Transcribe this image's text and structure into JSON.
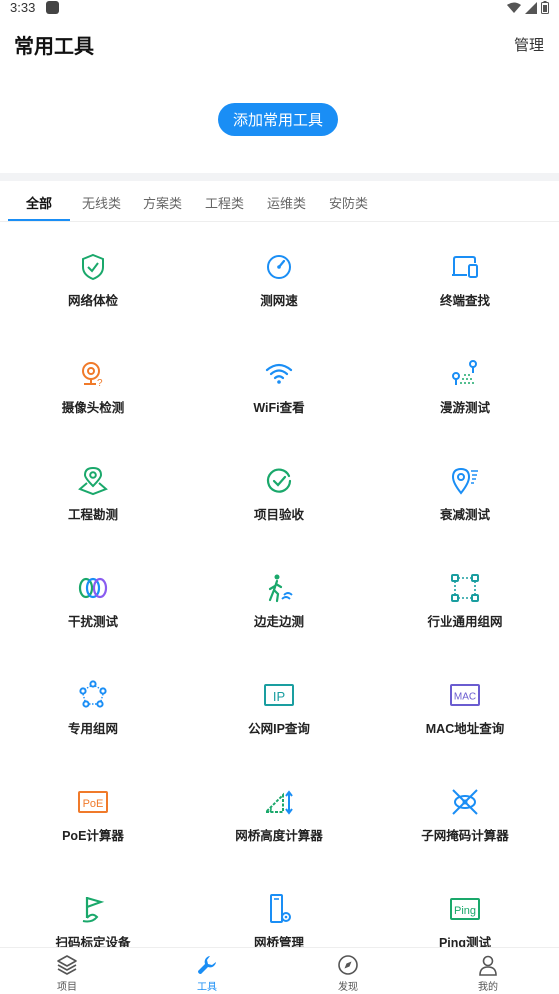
{
  "status": {
    "time": "3:33"
  },
  "header": {
    "title": "常用工具",
    "manage_label": "管理"
  },
  "add_button_label": "添加常用工具",
  "tabs": [
    {
      "label": "全部",
      "active": true
    },
    {
      "label": "无线类"
    },
    {
      "label": "方案类"
    },
    {
      "label": "工程类"
    },
    {
      "label": "运维类"
    },
    {
      "label": "安防类"
    }
  ],
  "tools": [
    {
      "label": "网络体检",
      "icon": "shield-check-icon",
      "color": "#1aa86b"
    },
    {
      "label": "测网速",
      "icon": "speedometer-icon",
      "color": "#1a8ef5"
    },
    {
      "label": "终端查找",
      "icon": "devices-icon",
      "color": "#1a8ef5"
    },
    {
      "label": "摄像头检测",
      "icon": "camera-check-icon",
      "color": "#f07a2a"
    },
    {
      "label": "WiFi查看",
      "icon": "wifi-icon",
      "color": "#1a8ef5"
    },
    {
      "label": "漫游测试",
      "icon": "roaming-icon",
      "color": "#1a8ef5"
    },
    {
      "label": "工程勘测",
      "icon": "map-pin-icon",
      "color": "#1aa86b"
    },
    {
      "label": "项目验收",
      "icon": "check-circle-icon",
      "color": "#1aa86b"
    },
    {
      "label": "衰减测试",
      "icon": "pin-signal-icon",
      "color": "#1a8ef5"
    },
    {
      "label": "干扰测试",
      "icon": "interference-rings-icon",
      "color": "#8a5cf0"
    },
    {
      "label": "边走边测",
      "icon": "walking-icon",
      "color": "#1aa86b"
    },
    {
      "label": "行业通用组网",
      "icon": "network-nodes-icon",
      "color": "#1a9ea0"
    },
    {
      "label": "专用组网",
      "icon": "ring-network-icon",
      "color": "#1a8ef5"
    },
    {
      "label": "公网IP查询",
      "icon": "ip-box-icon",
      "color": "#1a9ea0",
      "text": "IP"
    },
    {
      "label": "MAC地址查询",
      "icon": "mac-box-icon",
      "color": "#6a5cd0",
      "text": "MAC"
    },
    {
      "label": "PoE计算器",
      "icon": "poe-box-icon",
      "color": "#f07a2a",
      "text": "PoE"
    },
    {
      "label": "网桥高度计算器",
      "icon": "bridge-height-icon",
      "color": "#1aa86b"
    },
    {
      "label": "子网掩码计算器",
      "icon": "subnet-mask-icon",
      "color": "#1a8ef5"
    },
    {
      "label": "扫码标定设备",
      "icon": "flag-icon",
      "color": "#1aa86b"
    },
    {
      "label": "网桥管理",
      "icon": "bridge-device-icon",
      "color": "#1a8ef5"
    },
    {
      "label": "Ping测试",
      "icon": "ping-box-icon",
      "color": "#1aa86b",
      "text": "Ping"
    }
  ],
  "bottom_nav": [
    {
      "label": "项目",
      "icon": "layers-icon"
    },
    {
      "label": "工具",
      "icon": "wrench-icon",
      "active": true
    },
    {
      "label": "发现",
      "icon": "compass-icon"
    },
    {
      "label": "我的",
      "icon": "person-icon"
    }
  ],
  "colors": {
    "accent": "#1a8ef5",
    "green": "#1aa86b",
    "orange": "#f07a2a",
    "purple": "#8a5cf0",
    "teal": "#1a9ea0"
  }
}
